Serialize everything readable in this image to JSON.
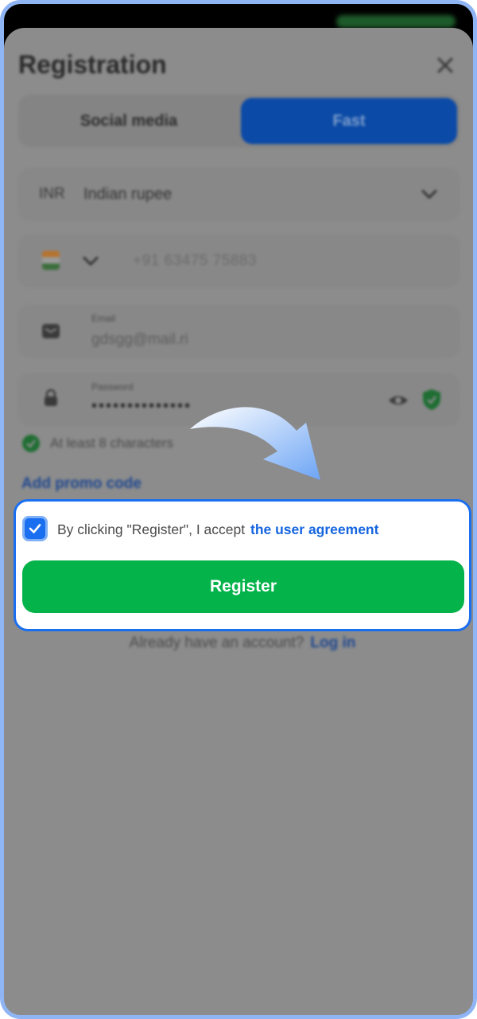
{
  "header": {
    "title": "Registration"
  },
  "tabs": [
    {
      "label": "Social media",
      "active": false
    },
    {
      "label": "Fast",
      "active": true
    }
  ],
  "form": {
    "currency": {
      "code": "INR",
      "name": "Indian rupee"
    },
    "phone": {
      "value": "+91 63475 75883"
    },
    "email": {
      "label": "Email",
      "value": "gdsgg@mail.ri"
    },
    "password": {
      "label": "Password",
      "value": "••••••••••••••"
    },
    "hint": "At least 8 characters",
    "promo_label": "Add promo code"
  },
  "agreement": {
    "text": "By clicking \"Register\", I accept",
    "link": "the user agreement",
    "checked": true
  },
  "register_label": "Register",
  "footer": {
    "question": "Already have an account?",
    "login_label": "Log in"
  },
  "colors": {
    "accent_blue": "#1a6ff0",
    "register_green": "#04b34a",
    "link_blue": "#1565e0"
  }
}
